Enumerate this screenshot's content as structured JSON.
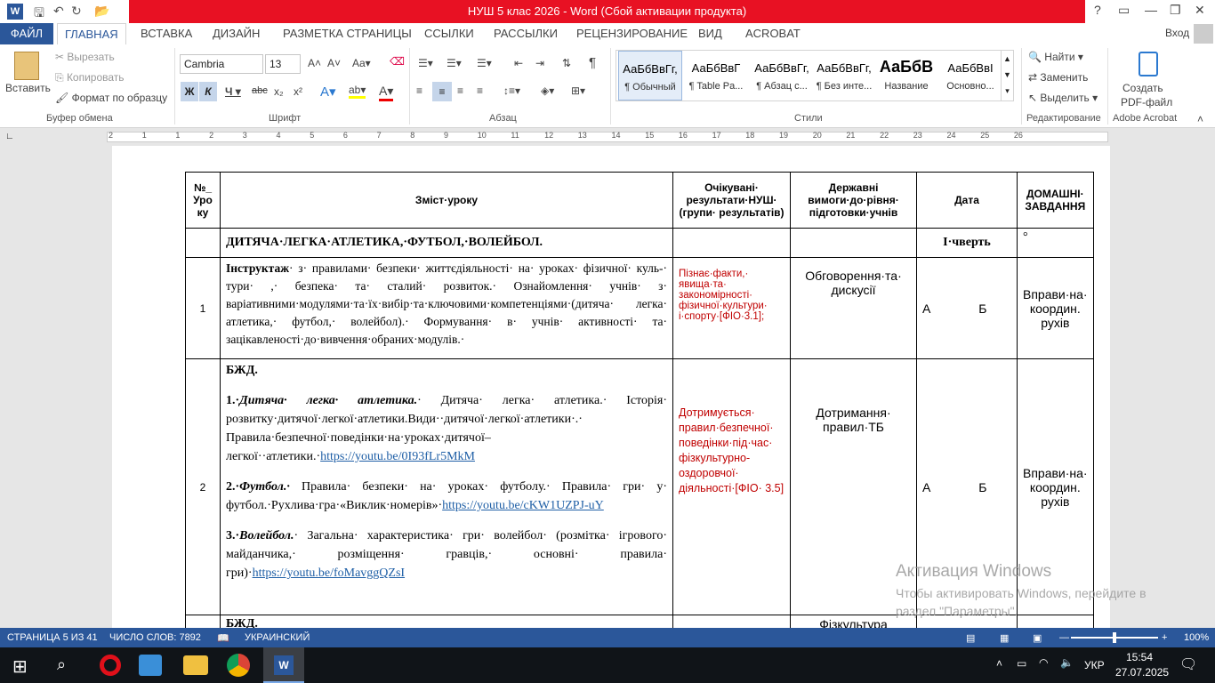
{
  "title": "НУШ 5 клас 2026 -  Word (Сбой активации продукта)",
  "window_controls": {
    "help": "?",
    "restore_ribbon": "▭",
    "minimize": "—",
    "maximize": "❐",
    "close": "✕"
  },
  "tabs": [
    "ФАЙЛ",
    "ГЛАВНАЯ",
    "ВСТАВКА",
    "ДИЗАЙН",
    "РАЗМЕТКА СТРАНИЦЫ",
    "ССЫЛКИ",
    "РАССЫЛКИ",
    "РЕЦЕНЗИРОВАНИЕ",
    "ВИД",
    "ACROBAT"
  ],
  "login": "Вход",
  "clipboard": {
    "paste": "Вставить",
    "cut": "Вырезать",
    "copy": "Копировать",
    "format_painter": "Формат по образцу",
    "label": "Буфер обмена"
  },
  "font": {
    "name": "Cambria",
    "size": "13",
    "label": "Шрифт"
  },
  "paragraph": {
    "label": "Абзац"
  },
  "styles": {
    "label": "Стили",
    "items": [
      {
        "preview": "АаБбВвГг,",
        "name": "¶ Обычный"
      },
      {
        "preview": "АаБбВвГ",
        "name": "¶ Table Pa..."
      },
      {
        "preview": "АаБбВвГг,",
        "name": "¶ Абзац с..."
      },
      {
        "preview": "АаБбВвГг,",
        "name": "¶ Без инте..."
      },
      {
        "preview": "АаБбВ",
        "name": "Название"
      },
      {
        "preview": "АаБбВвІ",
        "name": "Основно..."
      }
    ]
  },
  "editing": {
    "find": "Найти",
    "replace": "Заменить",
    "select": "Выделить",
    "label": "Редактирование"
  },
  "acrobat": {
    "create": "Создать",
    "pdf": "PDF-файл",
    "label": "Adobe Acrobat"
  },
  "ruler_numbers": [
    "2",
    "1",
    "1",
    "2",
    "3",
    "4",
    "5",
    "6",
    "7",
    "8",
    "9",
    "10",
    "11",
    "12",
    "13",
    "14",
    "15",
    "16",
    "17",
    "18",
    "19",
    "20",
    "21",
    "22",
    "23",
    "24",
    "25",
    "26"
  ],
  "table": {
    "headers": [
      "№_ Уро ку",
      "Зміст·уроку",
      "Очікувані· результати·НУШ· (групи· результатів)",
      "Державні вимоги·до·рівня· підготовки·учнів",
      "Дата",
      "ДОМАШНІ· ЗАВДАННЯ"
    ],
    "section_title": "ДИТЯЧА·ЛЕГКА·АТЛЕТИКА,·ФУТБОЛ,·ВОЛЕЙБОЛ.",
    "quarter": "І·чверть",
    "degree": "°",
    "row1": {
      "num": "1",
      "lead": "Інструктаж",
      "text": "· з· правилами· безпеки· життєдіяльності· на· уроках· фізичної· куль-· тури· ,· безпека· та· сталий· розвиток.· Ознайомлення· учнів· з· варіативними·модулями·та·їх·вибір·та·ключовими·компетенціями·(дитяча· легка· атлетика,· футбол,· волейбол).· Формування· в· учнів· активності· та· зацікавленості·до·вивчення·обраних·модулів.·",
      "results": "Пізнає·факти,· явища·та· закономірності· фізичної·культури· і·спорту·[ФІО·3.1];",
      "requirements": "Обговорення·та· дискусії",
      "date": "А Б",
      "homework": "Вправи·на· координ. рухів"
    },
    "row2": {
      "num": "2",
      "intro": "БЖД.",
      "p1_num": "1.·",
      "p1_title": "Дитяча· легка· атлетика.",
      "p1_text": "· Дитяча· легка· атлетика.· Історія· розвитку·дитячої·легкої·атлетики.Види··дитячої·легкої·атлетики·.· Правила·безпечної·поведінки·на·уроках·дитячої–легкої··атлетики.·",
      "p1_link": "https://youtu.be/0I93fLr5MkM",
      "p2_num": "2.·",
      "p2_title": "Футбол.·",
      "p2_text": " Правила· безпеки· на· уроках· футболу.· Правила· гри· у· футбол.·Рухлива·гра·«Виклик·номерів»·",
      "p2_link": "https://youtu.be/cKW1UZPJ-uY",
      "p3_num": "3.·",
      "p3_title": "Волейбол.",
      "p3_text": "· Загальна· характеристика· гри· волейбол· (розмітка· ігрового· майданчика,· розміщення· гравців,· основні· правила· гри)·",
      "p3_link": "https://youtu.be/foMavggQZsI",
      "results": "Дотримується· правил·безпечної· поведінки·під·час· фізкультурно- оздоровчої· діяльності·[ФІО· 3.5]",
      "requirements": "Дотримання· правил·ТБ",
      "date": "А Б",
      "homework": "Вправи·на· координ. рухів"
    },
    "row3": {
      "intro": "БЖД.",
      "requirements": "Фізкультура"
    }
  },
  "watermark": {
    "title": "Активация Windows",
    "text": "Чтобы активировать Windows, перейдите в раздел \"Параметры\"."
  },
  "status": {
    "page": "СТРАНИЦА 5 ИЗ 41",
    "words": "ЧИСЛО СЛОВ: 7892",
    "lang": "УКРАИНСКИЙ",
    "zoom": "100%"
  },
  "taskbar": {
    "lang": "УКР",
    "time": "15:54",
    "date": "27.07.2025"
  }
}
